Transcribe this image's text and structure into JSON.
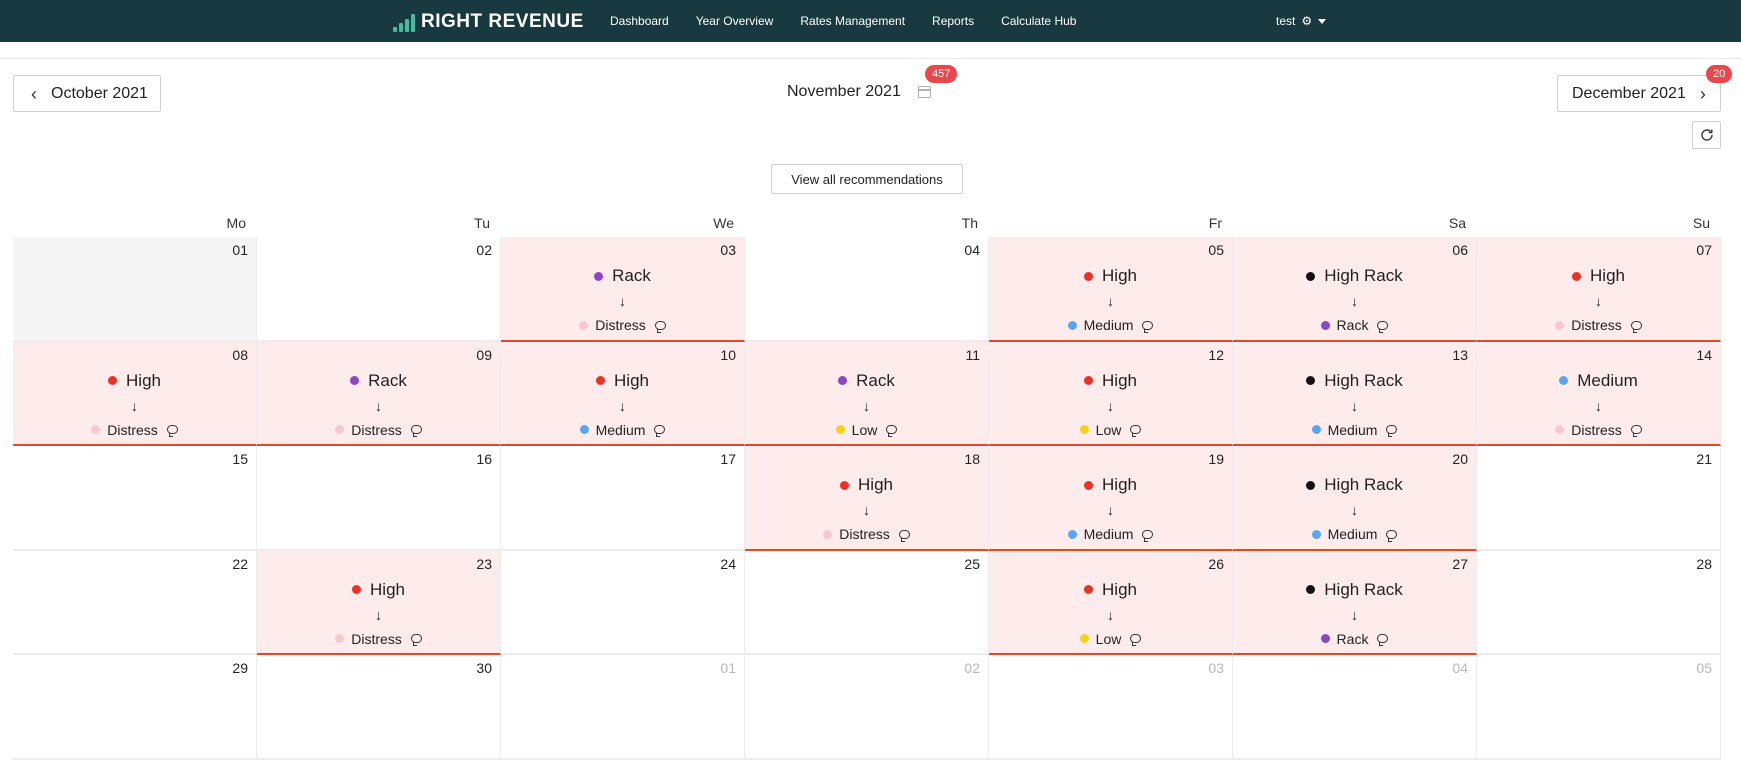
{
  "app": {
    "brand": "RIGHT REVENUE",
    "brand_color": "#3fbfa0",
    "topbar_color": "#17393f"
  },
  "nav": {
    "items": [
      {
        "label": "Dashboard"
      },
      {
        "label": "Year Overview"
      },
      {
        "label": "Rates Management"
      },
      {
        "label": "Reports"
      },
      {
        "label": "Calculate Hub"
      }
    ],
    "user": "test",
    "user_icon": "gear-icon"
  },
  "month_nav": {
    "previous": "October 2021",
    "current": "November 2021",
    "next": "December 2021",
    "current_badge": "457",
    "next_badge": "20"
  },
  "recommendations_button": "View all recommendations",
  "weekdays": [
    "Mo",
    "Tu",
    "We",
    "Th",
    "Fr",
    "Sa",
    "Su"
  ],
  "level_colors": {
    "High": "#e8332a",
    "High Rack": "#111111",
    "Rack": "#8e44c7",
    "Medium": "#5aa5ee",
    "Low": "#f2d21b",
    "Distress": "#f7c7cf"
  },
  "days": [
    {
      "num": "01",
      "state": "prev"
    },
    {
      "num": "02"
    },
    {
      "num": "03",
      "from": "Rack",
      "to": "Distress"
    },
    {
      "num": "04"
    },
    {
      "num": "05",
      "from": "High",
      "to": "Medium"
    },
    {
      "num": "06",
      "from": "High Rack",
      "to": "Rack"
    },
    {
      "num": "07",
      "from": "High",
      "to": "Distress"
    },
    {
      "num": "08",
      "from": "High",
      "to": "Distress"
    },
    {
      "num": "09",
      "from": "Rack",
      "to": "Distress"
    },
    {
      "num": "10",
      "from": "High",
      "to": "Medium"
    },
    {
      "num": "11",
      "from": "Rack",
      "to": "Low"
    },
    {
      "num": "12",
      "from": "High",
      "to": "Low"
    },
    {
      "num": "13",
      "from": "High Rack",
      "to": "Medium"
    },
    {
      "num": "14",
      "from": "Medium",
      "to": "Distress"
    },
    {
      "num": "15"
    },
    {
      "num": "16"
    },
    {
      "num": "17"
    },
    {
      "num": "18",
      "from": "High",
      "to": "Distress"
    },
    {
      "num": "19",
      "from": "High",
      "to": "Medium"
    },
    {
      "num": "20",
      "from": "High Rack",
      "to": "Medium"
    },
    {
      "num": "21"
    },
    {
      "num": "22"
    },
    {
      "num": "23",
      "from": "High",
      "to": "Distress"
    },
    {
      "num": "24"
    },
    {
      "num": "25"
    },
    {
      "num": "26",
      "from": "High",
      "to": "Low"
    },
    {
      "num": "27",
      "from": "High Rack",
      "to": "Rack"
    },
    {
      "num": "28"
    },
    {
      "num": "29"
    },
    {
      "num": "30"
    },
    {
      "num": "01",
      "state": "other"
    },
    {
      "num": "02",
      "state": "other"
    },
    {
      "num": "03",
      "state": "other"
    },
    {
      "num": "04",
      "state": "other"
    },
    {
      "num": "05",
      "state": "other"
    }
  ]
}
